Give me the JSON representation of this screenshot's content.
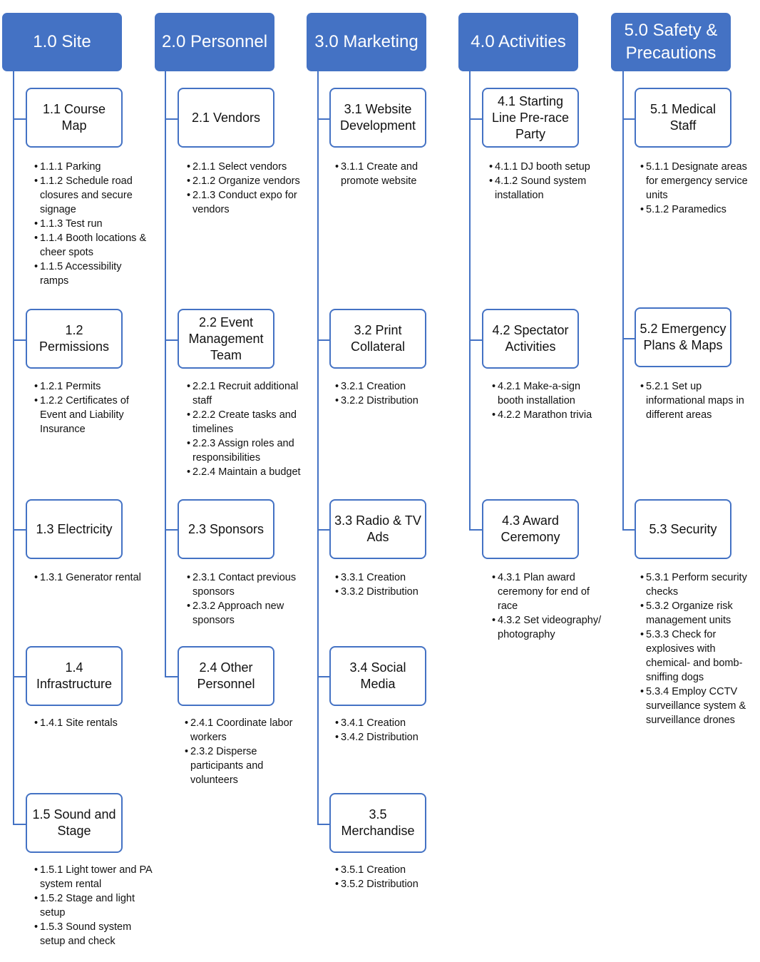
{
  "colors": {
    "accent": "#4472C4",
    "box_border": "#4472C4",
    "text": "#111111"
  },
  "columns": [
    {
      "title": "1.0  Site",
      "children": [
        {
          "label": "1.1  Course Map",
          "tasks": [
            "1.1.1  Parking",
            "1.1.2  Schedule road closures and secure signage",
            "1.1.3  Test run",
            "1.1.4  Booth locations & cheer spots",
            "1.1.5  Accessibility ramps"
          ]
        },
        {
          "label": "1.2 Permissions",
          "tasks": [
            "1.2.1  Permits",
            "1.2.2  Certificates of Event and Liability Insurance"
          ]
        },
        {
          "label": "1.3  Electricity",
          "tasks": [
            "1.3.1  Generator rental"
          ]
        },
        {
          "label": "1.4 Infrastructure",
          "tasks": [
            "1.4.1  Site rentals"
          ]
        },
        {
          "label": "1.5  Sound and Stage",
          "tasks": [
            "1.5.1  Light tower and PA system rental",
            "1.5.2  Stage and light setup",
            "1.5.3  Sound system setup and check"
          ]
        }
      ]
    },
    {
      "title": "2.0 Personnel",
      "children": [
        {
          "label": "2.1  Vendors",
          "tasks": [
            "2.1.1  Select vendors",
            "2.1.2  Organize vendors",
            "2.1.3  Conduct expo for vendors"
          ]
        },
        {
          "label": "2.2  Event Management Team",
          "tasks": [
            "2.2.1  Recruit additional staff",
            "2.2.2  Create tasks and timelines",
            "2.2.3  Assign roles and responsibilities",
            "2.2.4  Maintain a budget"
          ]
        },
        {
          "label": "2.3  Sponsors",
          "tasks": [
            "2.3.1  Contact previous sponsors",
            "2.3.2  Approach new sponsors"
          ]
        },
        {
          "label": "2.4  Other Personnel",
          "tasks": [
            "2.4.1  Coordinate labor workers",
            "2.3.2  Disperse participants and volunteers"
          ]
        }
      ]
    },
    {
      "title": "3.0 Marketing",
      "children": [
        {
          "label": "3.1  Website Development",
          "tasks": [
            "3.1.1  Create and promote website"
          ]
        },
        {
          "label": "3.2  Print Collateral",
          "tasks": [
            "3.2.1  Creation",
            "3.2.2  Distribution"
          ]
        },
        {
          "label": "3.3  Radio & TV Ads",
          "tasks": [
            "3.3.1  Creation",
            "3.3.2  Distribution"
          ]
        },
        {
          "label": "3.4  Social Media",
          "tasks": [
            "3.4.1  Creation",
            "3.4.2  Distribution"
          ]
        },
        {
          "label": "3.5 Merchandise",
          "tasks": [
            "3.5.1  Creation",
            "3.5.2  Distribution"
          ]
        }
      ]
    },
    {
      "title": "4.0  Activities",
      "children": [
        {
          "label": "4.1 Starting Line Pre-race Party",
          "tasks": [
            "4.1.1  DJ booth setup",
            "4.1.2  Sound system installation"
          ]
        },
        {
          "label": "4.2  Spectator Activities",
          "tasks": [
            "4.2.1  Make-a-sign booth installation",
            "4.2.2  Marathon trivia"
          ]
        },
        {
          "label": "4.3  Award Ceremony",
          "tasks": [
            "4.3.1  Plan award ceremony for end of race",
            "4.3.2  Set videography/ photography"
          ]
        }
      ]
    },
    {
      "title": "5.0  Safety & Precautions",
      "children": [
        {
          "label": "5.1  Medical Staff",
          "tasks": [
            "5.1.1  Designate areas for emergency service units",
            "5.1.2  Paramedics"
          ]
        },
        {
          "label": "5.2 Emergency Plans & Maps",
          "tasks": [
            "5.2.1  Set up informational maps in different areas"
          ]
        },
        {
          "label": "5.3  Security",
          "tasks": [
            "5.3.1  Perform security checks",
            "5.3.2  Organize risk management units",
            "5.3.3  Check for explosives with chemical- and bomb-sniffing dogs",
            "5.3.4  Employ CCTV surveillance system & surveillance drones"
          ]
        }
      ]
    }
  ]
}
